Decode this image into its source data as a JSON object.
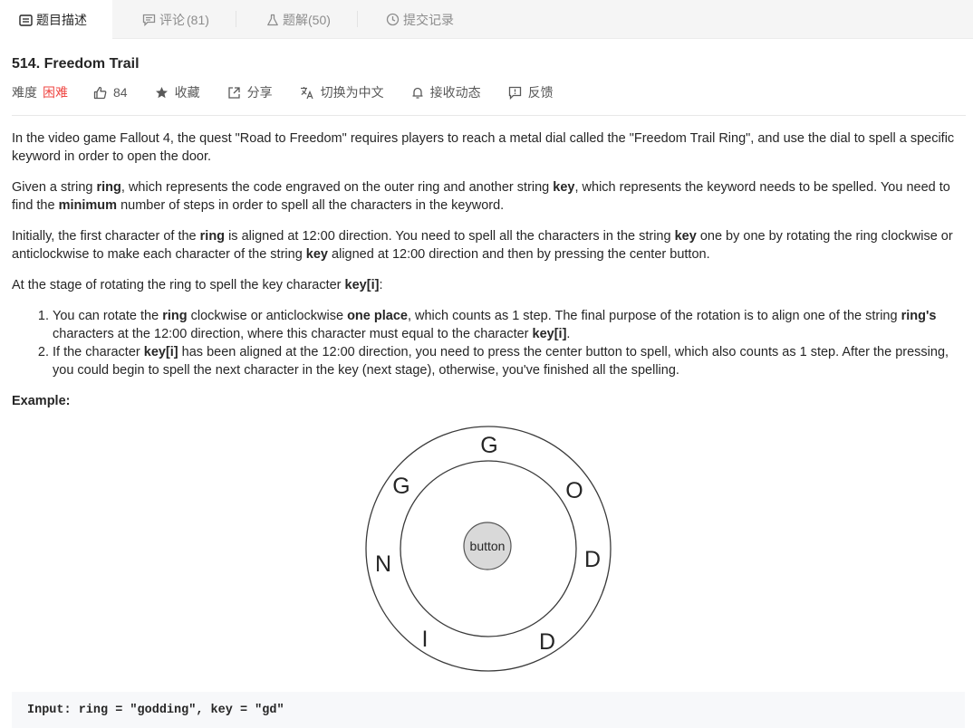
{
  "tabs": [
    {
      "label": "题目描述",
      "count": "",
      "icon": "description-icon",
      "active": true
    },
    {
      "label": "评论",
      "count": "(81)",
      "icon": "comment-icon",
      "active": false
    },
    {
      "label": "题解",
      "count": "(50)",
      "icon": "flask-icon",
      "active": false
    },
    {
      "label": "提交记录",
      "count": "",
      "icon": "clock-icon",
      "active": false
    }
  ],
  "problem": {
    "title": "514. Freedom Trail",
    "difficulty_label": "难度",
    "difficulty": "困难",
    "likes": "84",
    "favorite_label": "收藏",
    "share_label": "分享",
    "translate_label": "切换为中文",
    "notify_label": "接收动态",
    "feedback_label": "反馈"
  },
  "description": {
    "p1": "In the video game Fallout 4, the quest \"Road to Freedom\" requires players to reach a metal dial called the \"Freedom Trail Ring\", and use the dial to spell a specific keyword in order to open the door.",
    "p2": {
      "a": "Given a string ",
      "b1": "ring",
      "c": ", which represents the code engraved on the outer ring and another string ",
      "b2": "key",
      "d": ", which represents the keyword needs to be spelled. You need to find the ",
      "b3": "minimum",
      "e": " number of steps in order to spell all the characters in the keyword."
    },
    "p3": {
      "a": "Initially, the first character of the ",
      "b1": "ring",
      "c": " is aligned at 12:00 direction. You need to spell all the characters in the string ",
      "b2": "key",
      "d": " one by one by rotating the ring clockwise or anticlockwise to make each character of the string ",
      "b3": "key",
      "e": " aligned at 12:00 direction and then by pressing the center button."
    },
    "p4": {
      "a": "At the stage of rotating the ring to spell the key character ",
      "b1": "key[i]",
      "c": ":"
    },
    "li1": {
      "a": "You can rotate the ",
      "b1": "ring",
      "c": " clockwise or anticlockwise ",
      "b2": "one place",
      "d": ", which counts as 1 step. The final purpose of the rotation is to align one of the string ",
      "b3": "ring's",
      "e": " characters at the 12:00 direction, where this character must equal to the character ",
      "b4": "key[i]",
      "f": "."
    },
    "li2": {
      "a": "If the character ",
      "b1": "key[i]",
      "c": " has been aligned at the 12:00 direction, you need to press the center button to spell, which also counts as 1 step. After the pressing, you could begin to spell the next character in the key (next stage), otherwise, you've finished all the spelling."
    },
    "example_label": "Example:"
  },
  "ring_figure": {
    "button_label": "button",
    "letters": [
      "G",
      "O",
      "D",
      "D",
      "I",
      "N",
      "G"
    ]
  },
  "example_input": "Input: ring = \"godding\", key = \"gd\""
}
